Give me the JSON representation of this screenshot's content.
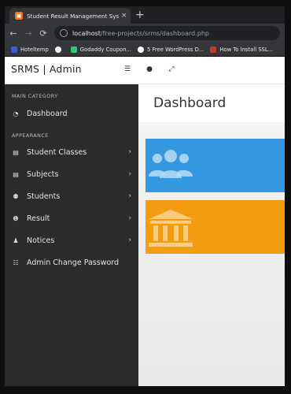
{
  "browser": {
    "tab_title": "Student Result Management Sys",
    "tab_close": "×",
    "new_tab": "+",
    "url_host": "localhost",
    "url_path": "/free-projects/srms/dashboard.php",
    "bookmarks": [
      "Hoteltemp",
      "Godaddy Coupon...",
      "5 Free WordPress D...",
      "How To Install SSL..."
    ]
  },
  "app": {
    "brand": "SRMS | Admin"
  },
  "sidebar": {
    "main_category_label": "MAIN CATEGORY",
    "appearance_label": "APPEARANCE",
    "items": [
      {
        "label": "Dashboard",
        "icon": "dashboard-icon"
      },
      {
        "label": "Student Classes",
        "icon": "file-icon"
      },
      {
        "label": "Subjects",
        "icon": "file-icon"
      },
      {
        "label": "Students",
        "icon": "users-icon"
      },
      {
        "label": "Result",
        "icon": "info-icon"
      },
      {
        "label": "Notices",
        "icon": "bell-icon"
      },
      {
        "label": "Admin Change Password",
        "icon": "list-icon"
      }
    ]
  },
  "main": {
    "page_title": "Dashboard"
  },
  "colors": {
    "sidebar_bg": "#2b2b2b",
    "card_blue": "#3398e0",
    "card_orange": "#f39c12"
  }
}
